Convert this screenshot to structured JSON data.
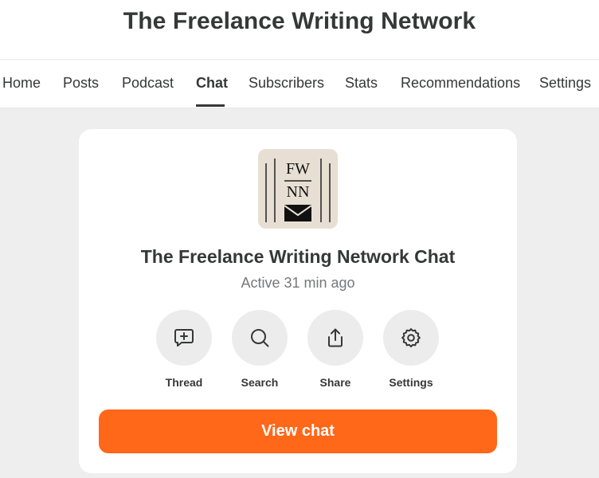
{
  "site": {
    "title": "The Freelance Writing Network"
  },
  "nav": {
    "items": [
      {
        "label": "Home"
      },
      {
        "label": "Posts"
      },
      {
        "label": "Podcast"
      },
      {
        "label": "Chat"
      },
      {
        "label": "Subscribers"
      },
      {
        "label": "Stats"
      },
      {
        "label": "Recommendations"
      },
      {
        "label": "Settings"
      }
    ],
    "active": "Chat"
  },
  "chat": {
    "logo_line1": "FW",
    "logo_line2": "NN",
    "title": "The Freelance Writing Network Chat",
    "status": "Active 31 min ago",
    "actions": [
      {
        "label": "Thread",
        "icon": "thread-icon"
      },
      {
        "label": "Search",
        "icon": "search-icon"
      },
      {
        "label": "Share",
        "icon": "share-icon"
      },
      {
        "label": "Settings",
        "icon": "gear-icon"
      }
    ],
    "cta_label": "View chat"
  },
  "colors": {
    "accent": "#ff6719",
    "background": "#eeeeee",
    "text": "#363737",
    "muted_text": "#77787a"
  }
}
